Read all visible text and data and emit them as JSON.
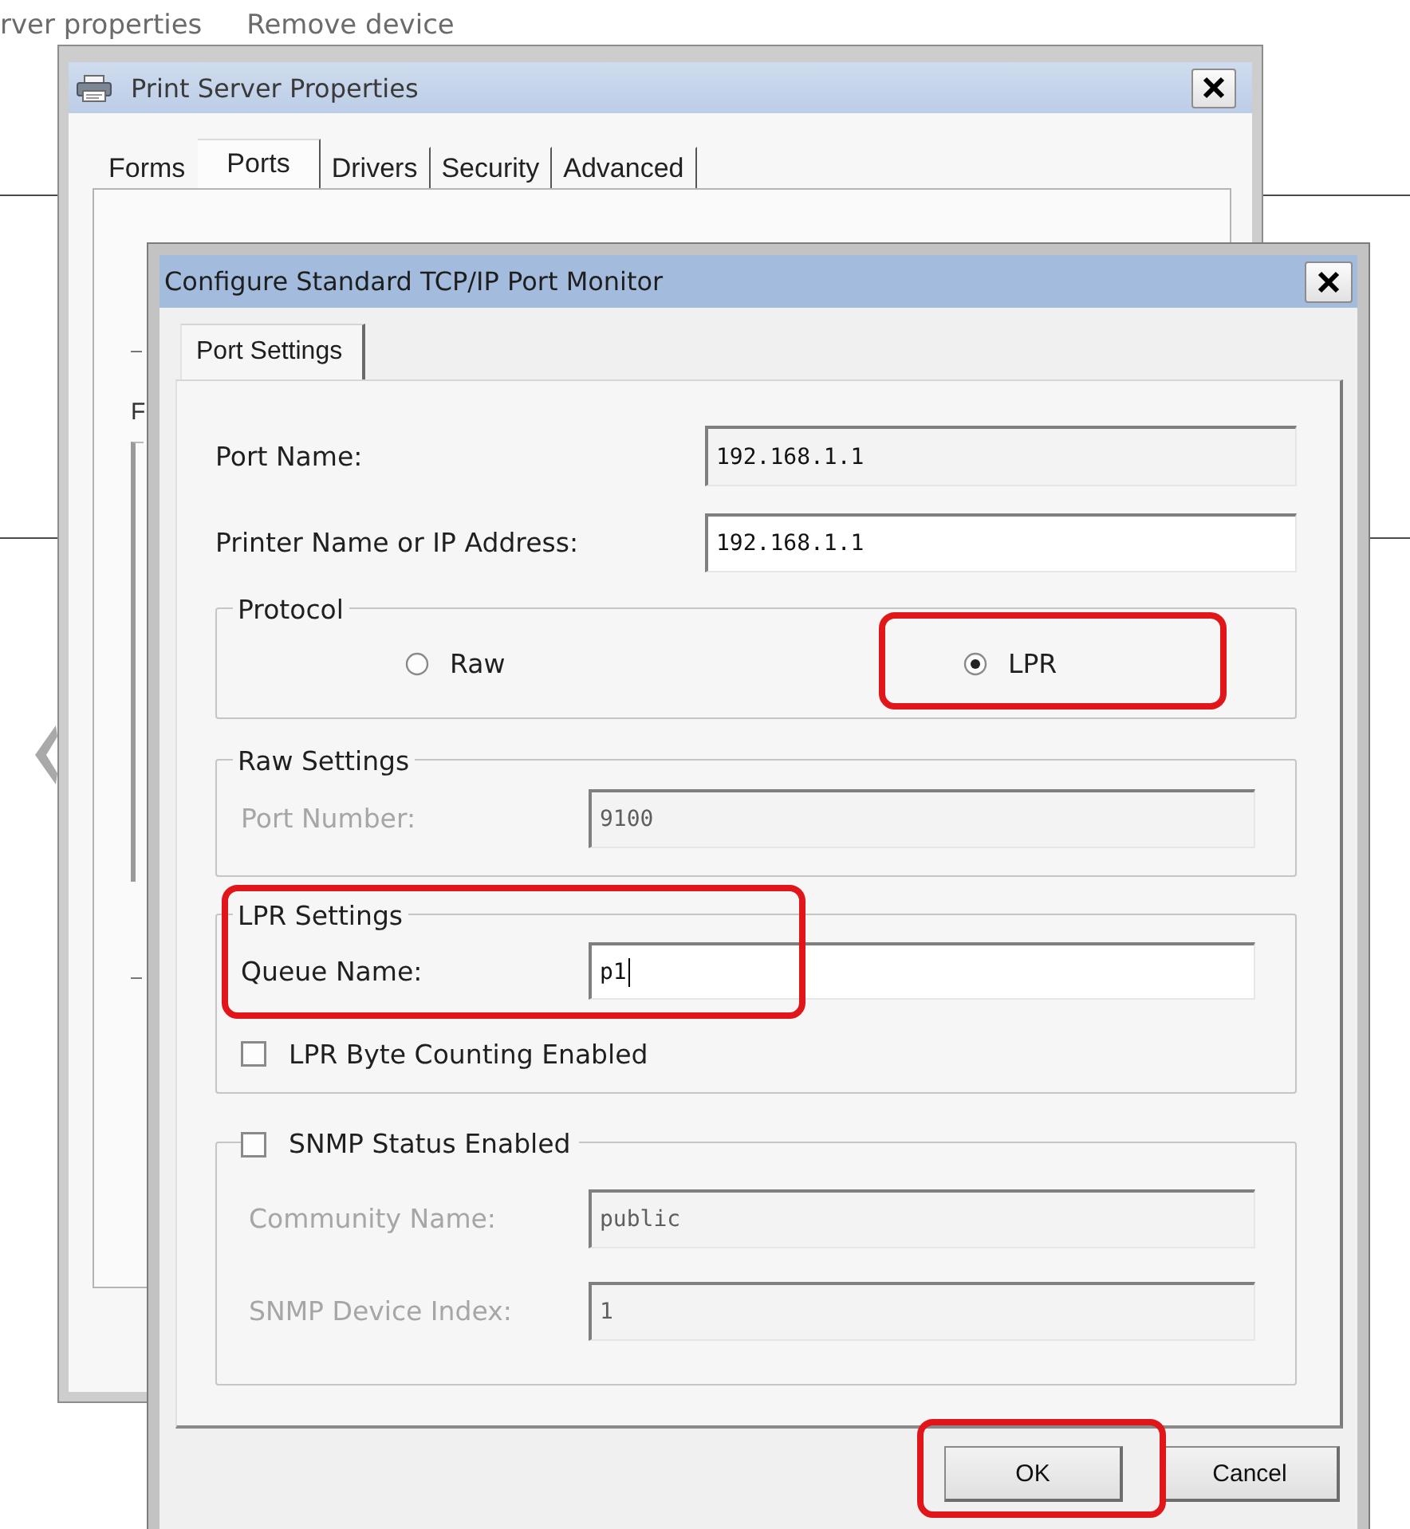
{
  "background_menu": [
    {
      "label": "rver properties"
    },
    {
      "label": "Remove device"
    }
  ],
  "print_server_window": {
    "title": "Print Server Properties",
    "tabs": [
      {
        "label": "Forms",
        "selected": false
      },
      {
        "label": "Ports",
        "selected": true
      },
      {
        "label": "Drivers",
        "selected": false
      },
      {
        "label": "Security",
        "selected": false
      },
      {
        "label": "Advanced",
        "selected": false
      }
    ],
    "list_label": "F"
  },
  "port_monitor_dialog": {
    "title": "Configure Standard TCP/IP Port Monitor",
    "tabs": [
      {
        "label": "Port Settings",
        "selected": true
      }
    ],
    "fields": [
      {
        "label": "Port Name:",
        "value": "192.168.1.1",
        "read_only": true
      },
      {
        "label": "Printer Name or IP Address:",
        "value": "192.168.1.1",
        "read_only": false
      }
    ],
    "protocol": {
      "title": "Protocol",
      "options": [
        {
          "label": "Raw",
          "selected": false,
          "highlighted": false
        },
        {
          "label": "LPR",
          "selected": true,
          "highlighted": true
        }
      ]
    },
    "raw_settings": {
      "title": "Raw Settings",
      "port_number": {
        "label": "Port Number:",
        "value": "9100",
        "disabled": true
      }
    },
    "lpr_settings": {
      "title": "LPR Settings",
      "highlighted": true,
      "queue_name": {
        "label": "Queue Name:",
        "value": "p1",
        "focused": true
      },
      "byte_counting": {
        "label": "LPR Byte Counting Enabled",
        "checked": false
      }
    },
    "snmp": {
      "label": "SNMP Status Enabled",
      "checked": false,
      "fields": [
        {
          "label": "Community Name:",
          "value": "public",
          "disabled": true
        },
        {
          "label": "SNMP Device Index:",
          "value": "1",
          "disabled": true
        }
      ]
    },
    "buttons": [
      {
        "label": "OK",
        "highlighted": true
      },
      {
        "label": "Cancel",
        "highlighted": false
      }
    ]
  }
}
